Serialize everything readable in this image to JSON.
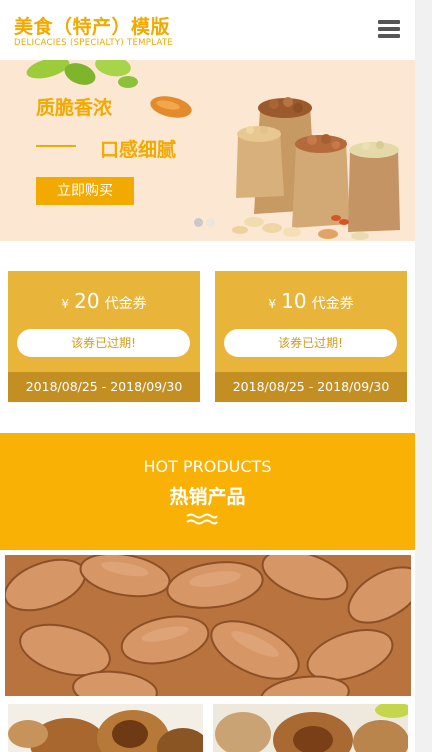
{
  "header": {
    "title": "美食（特产）模版",
    "subtitle": "DELICACIES (SPECIALTY) TEMPLATE",
    "menu_icon": "hamburger-menu-icon"
  },
  "banner": {
    "headline": "质脆香浓",
    "tagline": "口感细腻",
    "button_label": "立即购买",
    "slide_count": 2,
    "active_slide": 1
  },
  "coupons": [
    {
      "currency": "¥",
      "amount": "20",
      "unit": "代金券",
      "status": "该券已过期!",
      "dates": "2018/08/25 - 2018/09/30"
    },
    {
      "currency": "¥",
      "amount": "10",
      "unit": "代金券",
      "status": "该券已过期!",
      "dates": "2018/08/25 - 2018/09/30"
    }
  ],
  "hot": {
    "title_en": "HOT PRODUCTS",
    "title_cn": "热销产品"
  },
  "colors": {
    "accent": "#f2a900",
    "hot_bg": "#f9b106",
    "coupon_bg": "#e9b43a",
    "coupon_footer": "#c48f22",
    "banner_bg": "#fbe7d2"
  }
}
